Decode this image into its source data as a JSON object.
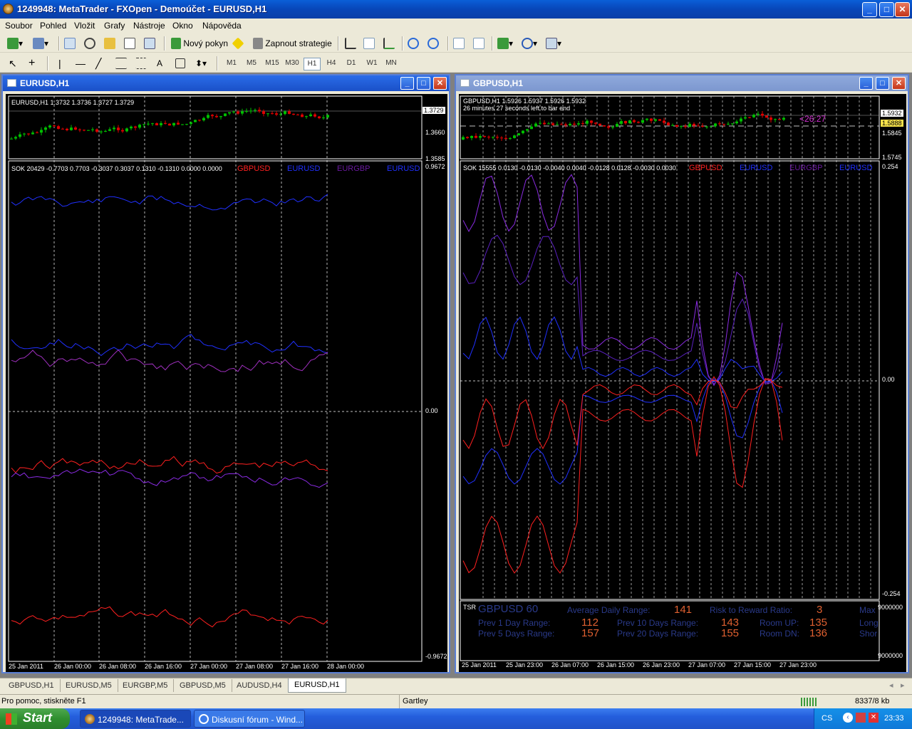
{
  "app": {
    "title": "1249948: MetaTrader - FXOpen - Demoúčet - EURUSD,H1"
  },
  "menu": [
    "Soubor",
    "Pohled",
    "Vložit",
    "Grafy",
    "Nástroje",
    "Okno",
    "Nápověda"
  ],
  "toolbar": {
    "new_order": "Nový pokyn",
    "strategy": "Zapnout strategie",
    "timeframes": [
      "M1",
      "M5",
      "M15",
      "M30",
      "H1",
      "H4",
      "D1",
      "W1",
      "MN"
    ],
    "active_tf": "H1"
  },
  "colors": {
    "gbp": "#ff2020",
    "eur": "#2030ff",
    "eurgbp": "#8a2be2",
    "up": "#00c000",
    "down": "#e00000"
  },
  "left": {
    "window_title": "EURUSD,H1",
    "price_header": "EURUSD,H1  1.3732 1.3736 1.3727 1.3729",
    "price_labels": [
      "1.3729",
      "1.3660",
      "1.3585"
    ],
    "ind_header": "SOK 20429 -0.7703 0.7703 -0.3037 0.3037 0.1310 -0.1310 0.0000 0.0000",
    "legend": [
      "GBPUSD",
      "EURUSD",
      "EURGBP",
      "EURUSD"
    ],
    "scale": [
      "0.9672",
      "0.00",
      "-0.9672"
    ],
    "xaxis": [
      "25 Jan 2011",
      "26 Jan 00:00",
      "26 Jan 08:00",
      "26 Jan 16:00",
      "27 Jan 00:00",
      "27 Jan 08:00",
      "27 Jan 16:00",
      "28 Jan 00:00"
    ]
  },
  "right": {
    "window_title": "GBPUSD,H1",
    "price_header": "GBPUSD,H1  1.5926 1.5937 1.5926 1.5932",
    "time_left": "26 minutes 27 seconds left to bar end",
    "countdown": "<26:27",
    "price_labels": [
      "1.5932",
      "1.5888",
      "1.5845",
      "1.5745"
    ],
    "ind_header": "SOK 15555 0.0130 -0.0130 -0.0040 0.0040 -0.0128 0.0128 -0.0030 0.0030",
    "legend": [
      "GBPUSD",
      "EURUSD",
      "EURGBP",
      "EURUSD"
    ],
    "scale": [
      "0.254",
      "0.00",
      "-0.254"
    ],
    "tsr": {
      "label": "TSR",
      "pair": "GBPUSD 60",
      "adr_label": "Average Daily Range:",
      "adr": "141",
      "rr_label": "Risk to Reward Ratio:",
      "rr": "3",
      "max": "Max",
      "p1_label": "Prev 1 Day Range:",
      "p1": "112",
      "p10_label": "Prev 10 Days Range:",
      "p10": "143",
      "up_label": "Room UP:",
      "up": "135",
      "long": "Long",
      "p5_label": "Prev 5 Days Range:",
      "p5": "157",
      "p20_label": "Prev 20 Days Range:",
      "p20": "155",
      "dn_label": "Room DN:",
      "dn": "136",
      "short": "Shor",
      "scale_top": "9000000",
      "scale_bot": "9000000"
    },
    "xaxis": [
      "25 Jan 2011",
      "25 Jan 23:00",
      "26 Jan 07:00",
      "26 Jan 15:00",
      "26 Jan 23:00",
      "27 Jan 07:00",
      "27 Jan 15:00",
      "27 Jan 23:00"
    ]
  },
  "tabs": [
    "GBPUSD,H1",
    "EURUSD,M5",
    "EURGBP,M5",
    "GBPUSD,M5",
    "AUDUSD,H4",
    "EURUSD,H1"
  ],
  "active_tab": "EURUSD,H1",
  "status": {
    "help": "Pro pomoc, stiskněte F1",
    "profile": "Gartley",
    "traffic": "8337/8 kb"
  },
  "taskbar": {
    "start": "Start",
    "task1": "1249948: MetaTrade...",
    "task2": "Diskusní fórum - Wind...",
    "lang": "CS",
    "time": "23:33"
  }
}
